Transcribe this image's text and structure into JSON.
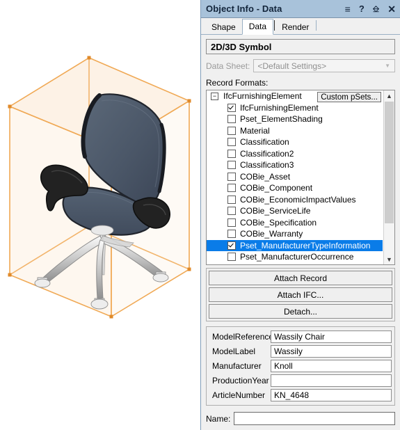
{
  "window": {
    "title": "Object Info - Data",
    "icons": [
      {
        "name": "menu-icon",
        "glyph": "≡"
      },
      {
        "name": "help-icon",
        "glyph": "?"
      },
      {
        "name": "pin-icon",
        "glyph": "丨"
      },
      {
        "name": "close-icon",
        "glyph": "✕"
      }
    ]
  },
  "tabs": [
    {
      "label": "Shape",
      "active": false
    },
    {
      "label": "Data",
      "active": true
    },
    {
      "label": "Render",
      "active": false
    }
  ],
  "symbol": {
    "header": "2D/3D Symbol",
    "data_sheet_label": "Data Sheet:",
    "data_sheet_value": "<Default Settings>",
    "data_sheet_enabled": false
  },
  "record_formats": {
    "label": "Record Formats:",
    "custom_psets_button": "Custom pSets...",
    "root": {
      "label": "IfcFurnishingElement",
      "expanded": true,
      "expander_glyph": "−"
    },
    "items": [
      {
        "label": "IfcFurnishingElement",
        "checked": true,
        "selected": false
      },
      {
        "label": "Pset_ElementShading",
        "checked": false,
        "selected": false
      },
      {
        "label": "Material",
        "checked": false,
        "selected": false
      },
      {
        "label": "Classification",
        "checked": false,
        "selected": false
      },
      {
        "label": "Classification2",
        "checked": false,
        "selected": false
      },
      {
        "label": "Classification3",
        "checked": false,
        "selected": false
      },
      {
        "label": "COBie_Asset",
        "checked": false,
        "selected": false
      },
      {
        "label": "COBie_Component",
        "checked": false,
        "selected": false
      },
      {
        "label": "COBie_EconomicImpactValues",
        "checked": false,
        "selected": false
      },
      {
        "label": "COBie_ServiceLife",
        "checked": false,
        "selected": false
      },
      {
        "label": "COBie_Specification",
        "checked": false,
        "selected": false
      },
      {
        "label": "COBie_Warranty",
        "checked": false,
        "selected": false
      },
      {
        "label": "Pset_ManufacturerTypeInformation",
        "checked": true,
        "selected": true
      },
      {
        "label": "Pset_ManufacturerOccurrence",
        "checked": false,
        "selected": false
      }
    ],
    "scroll_up_glyph": "⌃",
    "scroll_down_glyph": "⌄"
  },
  "actions": [
    {
      "label": "Attach Record"
    },
    {
      "label": "Attach IFC..."
    },
    {
      "label": "Detach..."
    }
  ],
  "properties": [
    {
      "key": "ModelReference",
      "value": "Wassily Chair"
    },
    {
      "key": "ModelLabel",
      "value": "Wassily"
    },
    {
      "key": "Manufacturer",
      "value": "Knoll"
    },
    {
      "key": "ProductionYear",
      "value": ""
    },
    {
      "key": "ArticleNumber",
      "value": "KN_4648"
    }
  ],
  "name_field": {
    "label": "Name:",
    "value": ""
  },
  "viewport": {
    "object": "office-chair-3d-model",
    "selection_box_color": "#f0a955",
    "selection_fill_color": "#fdf0e2",
    "upholstery_color": "#4e5b70",
    "frame_color": "#232323",
    "base_color": "#cfcfcf"
  }
}
